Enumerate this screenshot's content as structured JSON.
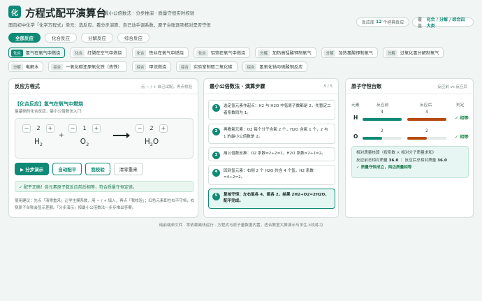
{
  "header": {
    "logo": "化",
    "title": "方程式配平演算台",
    "subtitle": "最小公倍数法 · 分步推演 · 质量守恒实时校验",
    "description": "面向初中化学「化学方程式」单元：选反应、看分步演算、自己动手调系数，原子台账逐项核对是否守恒",
    "library_prefix": "反应库",
    "library_count": "12",
    "library_suffix": "个经典反应",
    "coverage_prefix": "覆盖",
    "coverage_value": "化合 / 分解 / 综合四大类"
  },
  "tabs": [
    {
      "label": "全部反应",
      "active": true
    },
    {
      "label": "化合反应",
      "active": false
    },
    {
      "label": "分解反应",
      "active": false
    },
    {
      "label": "综合反应",
      "active": false
    }
  ],
  "reactions": [
    {
      "tag": "化合",
      "name": "氢气在氧气中燃烧",
      "selected": true
    },
    {
      "tag": "化合",
      "name": "红磷在空气中燃烧",
      "selected": false
    },
    {
      "tag": "化合",
      "name": "铁丝在氧气中燃烧",
      "selected": false
    },
    {
      "tag": "化合",
      "name": "铝箔在氧气中燃烧",
      "selected": false
    },
    {
      "tag": "分解",
      "name": "加热高锰酸钾制氧气",
      "selected": false
    },
    {
      "tag": "分解",
      "name": "加热氯酸钾制氧气",
      "selected": false
    },
    {
      "tag": "分解",
      "name": "过氧化氢分解制氧气",
      "selected": false
    },
    {
      "tag": "分解",
      "name": "电解水",
      "selected": false
    },
    {
      "tag": "综合",
      "name": "一氧化碳还原氧化铁（炼铁）",
      "selected": false
    },
    {
      "tag": "综合",
      "name": "甲烷燃烧",
      "selected": false
    },
    {
      "tag": "综合",
      "name": "实验室制取二氧化碳",
      "selected": false
    },
    {
      "tag": "综合",
      "name": "氢氧化钠与硫酸铜反应",
      "selected": false
    }
  ],
  "equation_panel": {
    "title": "反应方程式",
    "hint": "点 − / + 自己试配，再点校验",
    "reaction_title": "【化合反应】氢气在氧气中燃烧",
    "reaction_sub": "最基础的化合反应，最小公倍数法入门",
    "terms": [
      {
        "coef": "2",
        "symbol": "H",
        "sub": "2",
        "sym2": "",
        "sub2": ""
      },
      {
        "coef": "1",
        "symbol": "O",
        "sub": "2",
        "sym2": "",
        "sub2": ""
      },
      {
        "coef": "2",
        "symbol": "H",
        "sub": "2",
        "sym2": "O",
        "sub2": ""
      }
    ],
    "minus": "−",
    "plus": "+",
    "buttons": {
      "step": "▶ 分步演示",
      "auto": "自动配平",
      "check": "我校验",
      "reset": "清零重来"
    },
    "result": "✓ 配平正确！各元素原子数反应前后相等，符合质量守恒定律。",
    "usage": "使用建议：先点「清零重来」让学生摸系数，用 − / + 填入，再点「我校验」；红色元素即左右不守恒，右侧原子台账会显示差额。「分步演示」按最小公倍数法一步步推出答案。"
  },
  "steps_panel": {
    "title": "最小公倍数法 · 演算步骤",
    "progress": "5 / 5",
    "steps": [
      {
        "num": "1",
        "text": "选定氢元素作起点：H2 与 H2O 中氢原子数都是 2，先暂定二者系数同为 1。",
        "current": false
      },
      {
        "num": "2",
        "text": "再看氧元素：O2 每个分子含氧 2 个，H2O 含氧 1 个，2 与 1 的最小公倍数是 2。",
        "current": false
      },
      {
        "num": "3",
        "text": "用公倍数反推：O2 系数=2÷2=1，H2O 系数=2÷1=2。",
        "current": false
      },
      {
        "num": "4",
        "text": "回到氢元素：右侧 2 个 H2O 共含 4 个氢，H2 系数=4÷2=2。",
        "current": false
      },
      {
        "num": "5",
        "text": "复核守恒：左右氢各 4、氧各 2，结果 2H2+O2=2H2O，配平完成。",
        "current": true
      }
    ]
  },
  "ledger_panel": {
    "title": "原子守恒台账",
    "hint": "反应前 vs 反应后",
    "col_element": "元素",
    "col_before": "反应前",
    "col_after": "反应后",
    "col_verdict": "判定",
    "rows": [
      {
        "element": "H",
        "before": "4",
        "after": "4",
        "before_frac": 1.0,
        "after_frac": 1.0,
        "verdict": "✓ 相等"
      },
      {
        "element": "O",
        "before": "2",
        "after": "2",
        "before_frac": 0.5,
        "after_frac": 0.5,
        "verdict": "✓ 相等"
      }
    ],
    "summary_line1": "相对质量核算（按系数 × 相对分子质量求和）",
    "summary_before_label": "反应前总相对质量",
    "summary_before_value": "36.0",
    "summary_after_label": "反应后总相对质量",
    "summary_after_value": "36.0",
    "summary_ok": "✓ 质量守恒成立，两边质量相等",
    "colors": {
      "before": "#0f8a76",
      "after": "#b54a12"
    }
  },
  "footer": "纯前端单文件 · 零依赖离线运行 · 方程式与原子量数据内置，适合教室大屏演示与学生上机练习"
}
